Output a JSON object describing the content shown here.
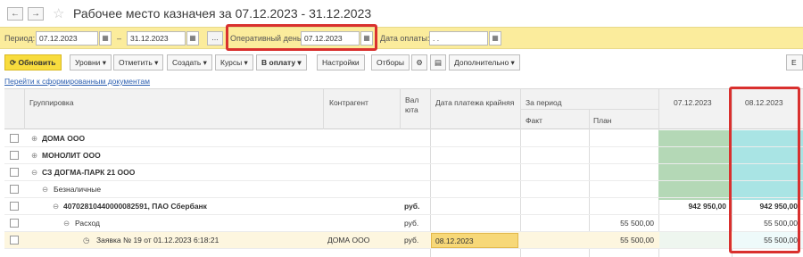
{
  "window": {
    "title": "Рабочее место казначея  за 07.12.2023 - 31.12.2023",
    "back_icon": "←",
    "forward_icon": "→",
    "star_icon": "☆"
  },
  "filters": {
    "period_label": "Период:",
    "period_from": "07.12.2023",
    "dash": "–",
    "period_to": "31.12.2023",
    "more_btn": "...",
    "operday_label": "Оперативный день:",
    "operday_value": "07.12.2023",
    "paydate_label": "Дата оплаты:",
    "paydate_value": " .  .",
    "cal_icon": "▦"
  },
  "toolbar": {
    "refresh": "Обновить",
    "levels": "Уровни ▾",
    "mark": "Отметить ▾",
    "create": "Создать ▾",
    "rates": "Курсы ▾",
    "to_pay": "В оплату ▾",
    "settings": "Настройки",
    "selections": "Отборы",
    "more": "Дополнительно ▾",
    "right_btn": "Е"
  },
  "link_text": "Перейти к сформированным документам",
  "columns": {
    "grouping": "Группировка",
    "counterparty": "Контрагент",
    "currency": "Вал юта",
    "deadline": "Дата платежа крайняя",
    "for_period": "За период",
    "fact": "Факт",
    "plan": "План",
    "d1": "07.12.2023",
    "d2": "08.12.2023"
  },
  "rows": [
    {
      "label": "ДОМА ООО",
      "bold": true
    },
    {
      "label": "МОНОЛИТ ООО",
      "bold": true
    },
    {
      "label": "СЗ ДОГМА-ПАРК 21 ООО",
      "bold": true
    },
    {
      "label": "Безналичные"
    },
    {
      "label": "40702810440000082591, ПАО Сбербанк",
      "bold": true,
      "currency": "руб.",
      "d1": "942 950,00",
      "d2": "942 950,00"
    },
    {
      "label": "Расход",
      "currency": "руб.",
      "plan": "55 500,00",
      "d2": "55 500,00"
    },
    {
      "label": "Заявка № 19 от 01.12.2023 6:18:21",
      "counterparty": "ДОМА ООО",
      "currency": "руб.",
      "deadline": "08.12.2023",
      "plan": "55 500,00",
      "d2": "55 500,00"
    }
  ]
}
